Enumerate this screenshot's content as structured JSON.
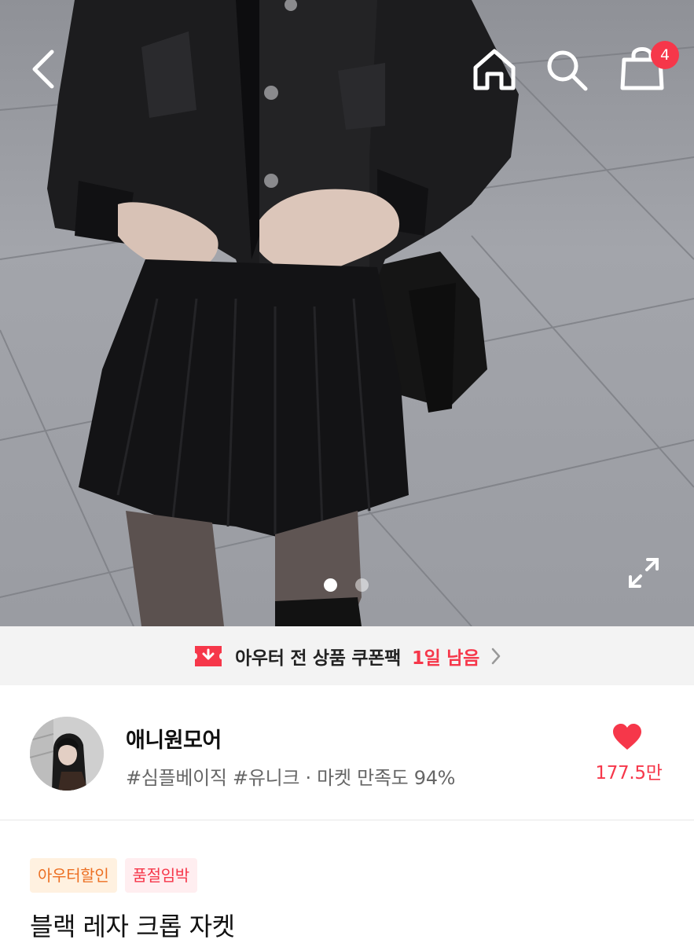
{
  "header": {
    "back_icon": "chevron-left-icon",
    "home_icon": "home-icon",
    "search_icon": "search-icon",
    "bag_icon": "shopping-bag-icon",
    "cart_count": "4",
    "expand_icon": "expand-icon"
  },
  "gallery": {
    "current_index": 1,
    "total": 2
  },
  "coupon": {
    "icon": "coupon-icon",
    "text": "아우터 전 상품 쿠폰팩",
    "remaining": "1일 남음"
  },
  "seller": {
    "name": "애니원모어",
    "tags": "#심플베이직 #유니크 · 마켓 만족도 94%",
    "like_count": "177.5만"
  },
  "product": {
    "badges": [
      "아우터할인",
      "품절임박"
    ],
    "title": "블랙 레자 크롭 자켓"
  },
  "colors": {
    "accent": "#f6374a",
    "coupon_bg": "#f3f3f3",
    "badge_orange": "#ec6f22"
  }
}
